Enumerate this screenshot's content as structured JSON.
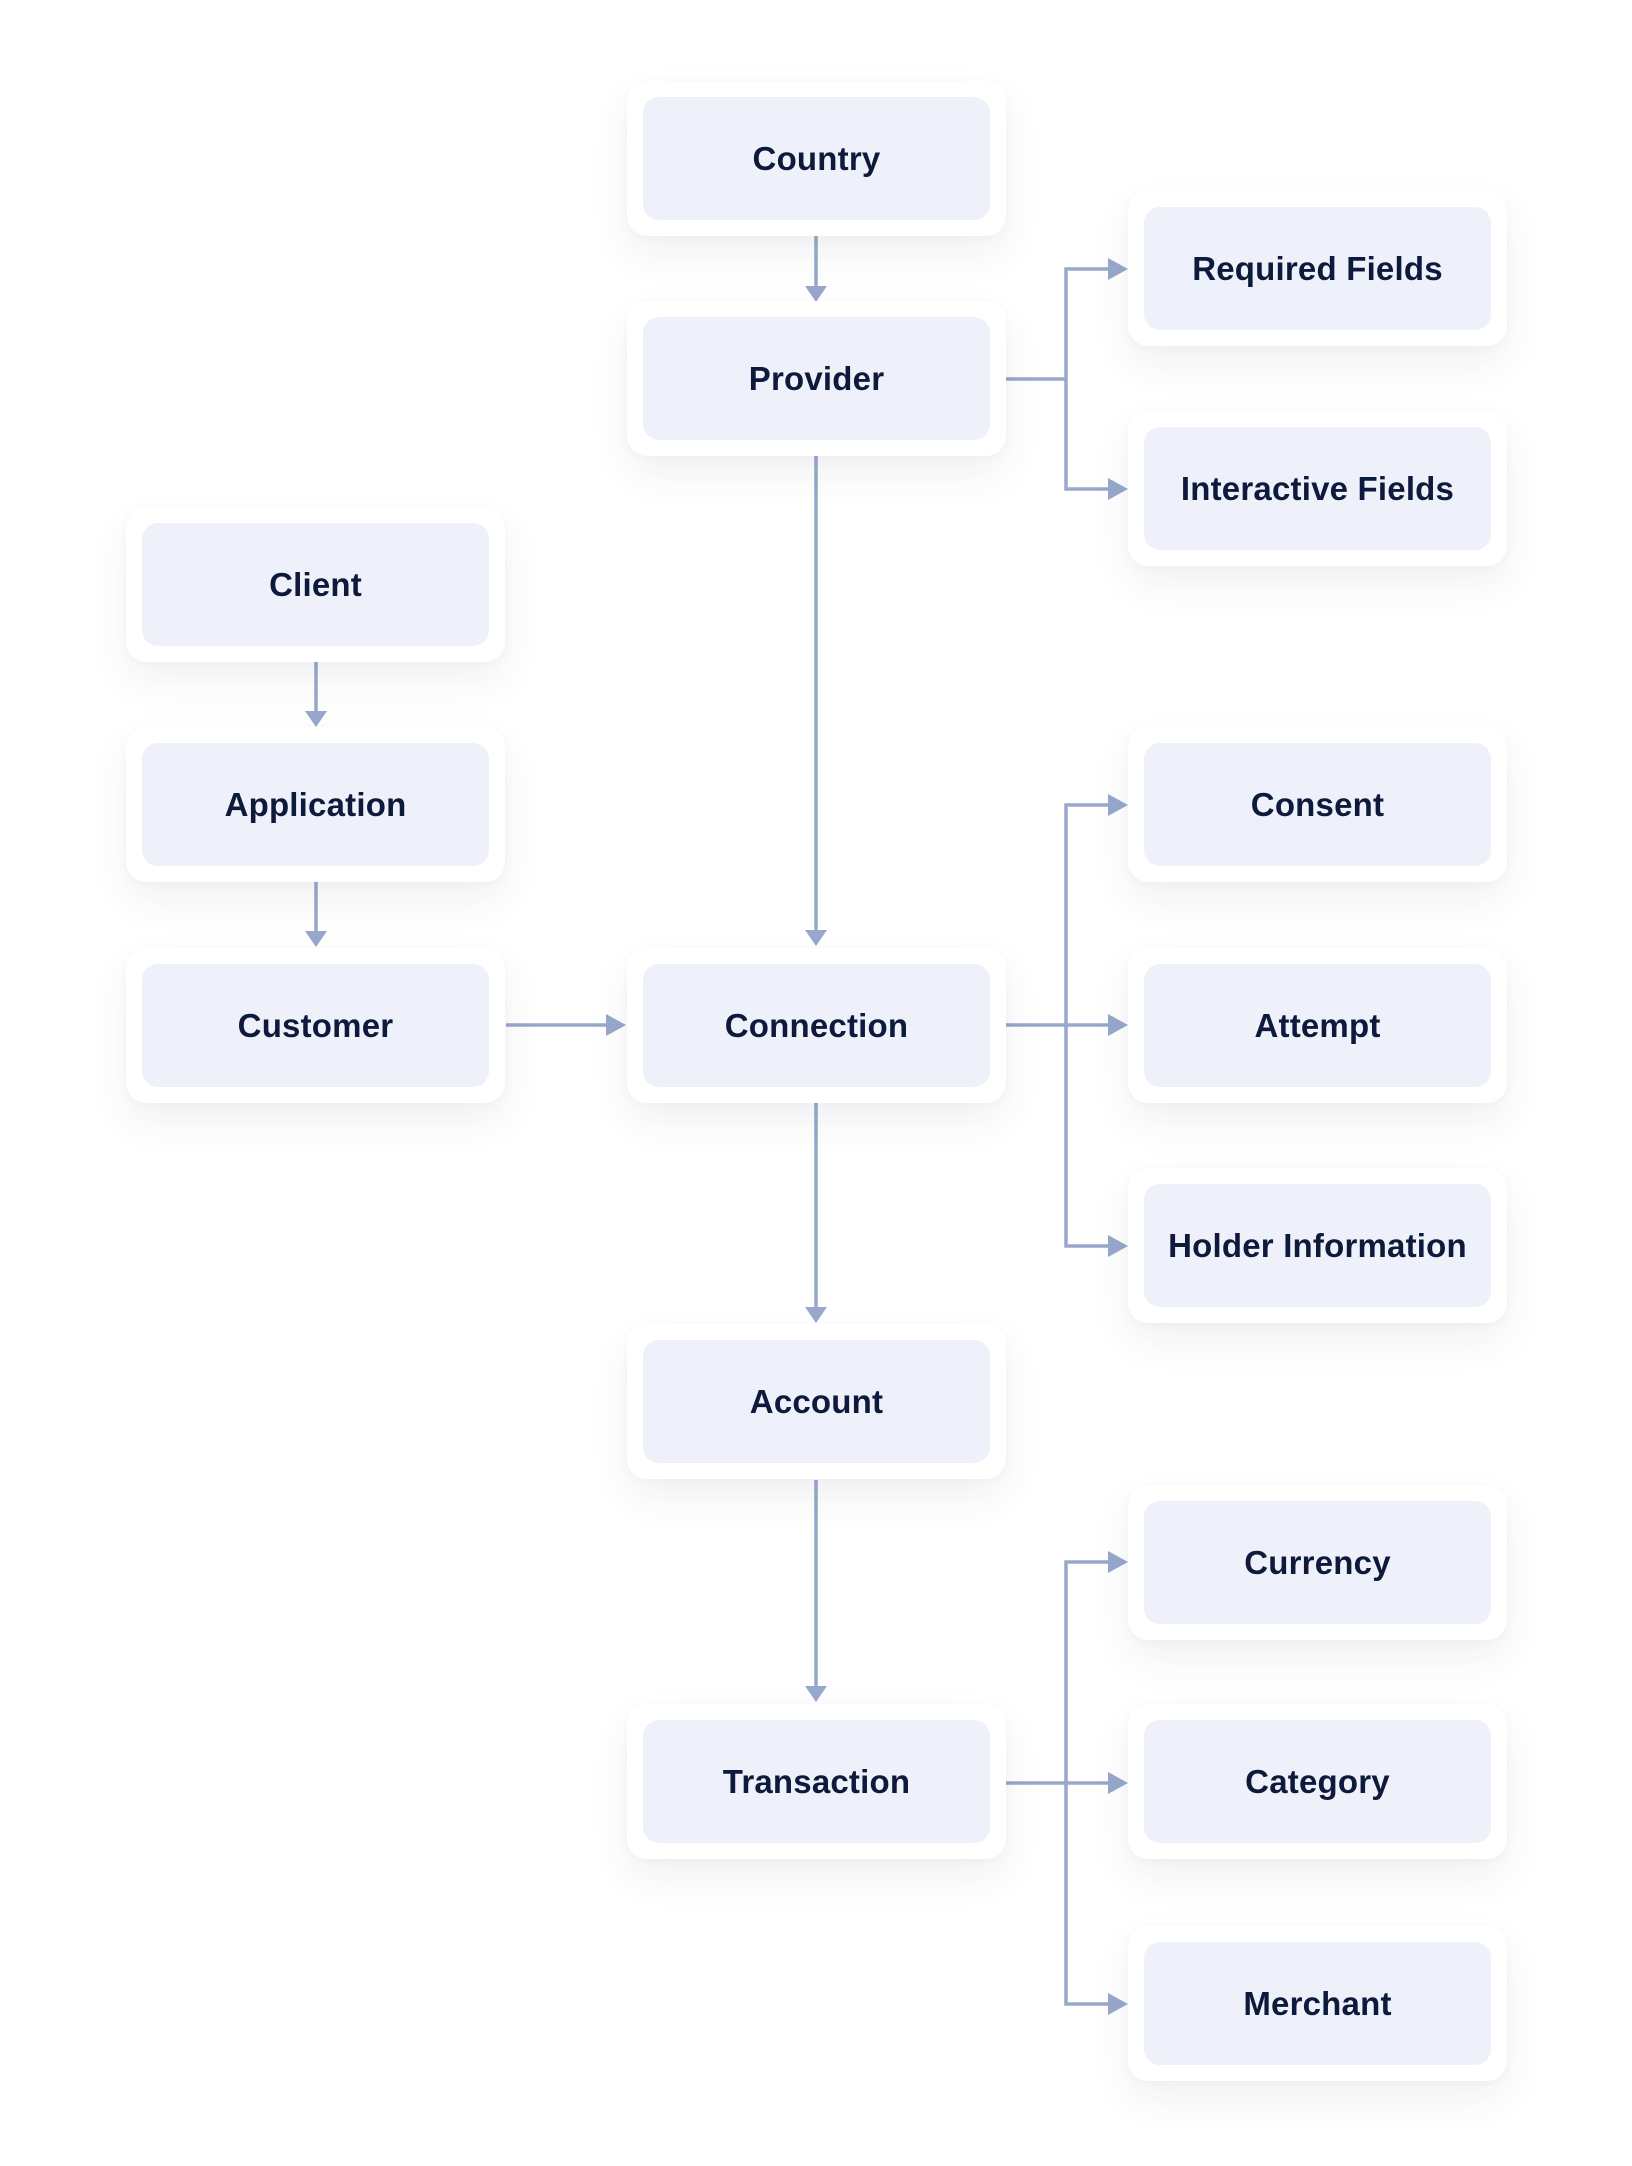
{
  "colors": {
    "node_fill": "#eef1f9",
    "card": "#ffffff",
    "connector": "#98a8cc",
    "text": "#0e1a3b"
  },
  "nodes": {
    "country": "Country",
    "provider": "Provider",
    "required_fields": "Required Fields",
    "interactive_fields": "Interactive Fields",
    "client": "Client",
    "application": "Application",
    "customer": "Customer",
    "connection": "Connection",
    "consent": "Consent",
    "attempt": "Attempt",
    "holder_information": "Holder Information",
    "account": "Account",
    "transaction": "Transaction",
    "currency": "Currency",
    "category": "Category",
    "merchant": "Merchant"
  },
  "edges": [
    [
      "Country",
      "Provider"
    ],
    [
      "Provider",
      "Required Fields"
    ],
    [
      "Provider",
      "Interactive Fields"
    ],
    [
      "Provider",
      "Connection"
    ],
    [
      "Client",
      "Application"
    ],
    [
      "Application",
      "Customer"
    ],
    [
      "Customer",
      "Connection"
    ],
    [
      "Connection",
      "Consent"
    ],
    [
      "Connection",
      "Attempt"
    ],
    [
      "Connection",
      "Holder Information"
    ],
    [
      "Connection",
      "Account"
    ],
    [
      "Account",
      "Transaction"
    ],
    [
      "Transaction",
      "Currency"
    ],
    [
      "Transaction",
      "Category"
    ],
    [
      "Transaction",
      "Merchant"
    ]
  ]
}
